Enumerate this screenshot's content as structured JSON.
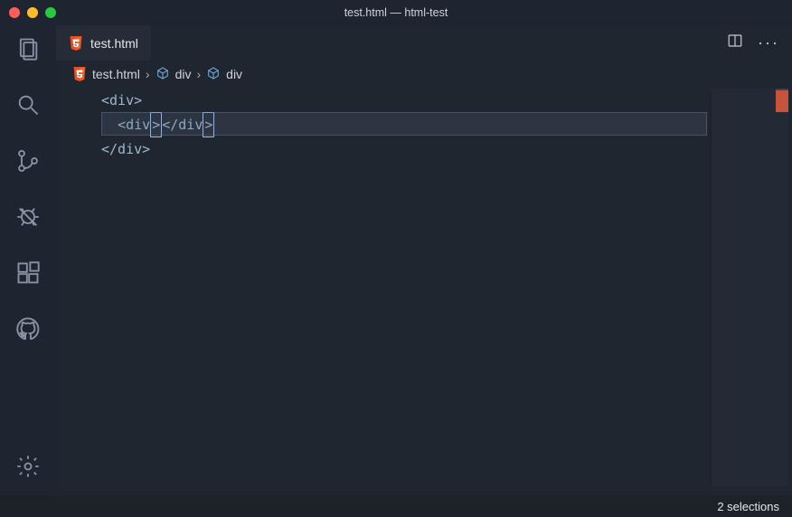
{
  "window": {
    "title": "test.html — html-test"
  },
  "tab": {
    "filename": "test.html"
  },
  "breadcrumb": {
    "file": "test.html",
    "part1": "div",
    "part2": "div"
  },
  "code": {
    "line1": "<div>",
    "line2_indent": "  ",
    "line2_open": "<div",
    "line2_close1": ">",
    "line2_end": "</div",
    "line2_close2": ">",
    "line3": "</div>"
  },
  "status": {
    "selections": "2 selections"
  }
}
